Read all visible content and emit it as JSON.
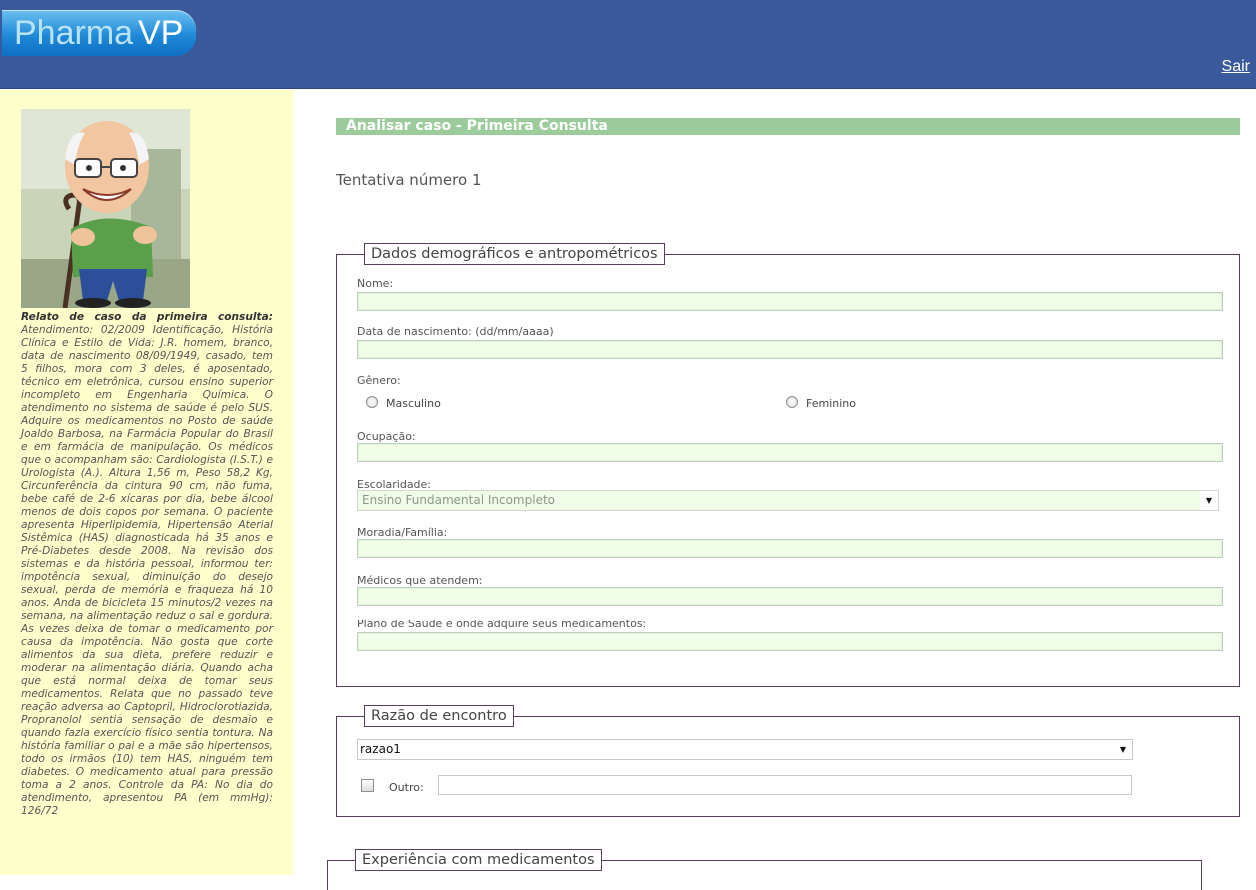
{
  "app": {
    "logo_left": "Pharma",
    "logo_right": "VP",
    "logout": "Sair"
  },
  "sidebar": {
    "case_title": "Relato de caso da primeira consulta:",
    "case_text": "Atendimento: 02/2009 Identificação, História Clínica e Estilo de Vida: J.R. homem, branco, data de nascimento 08/09/1949, casado, tem 5 filhos, mora com 3 deles, é aposentado, técnico em eletrônica, cursou ensino superior incompleto em Engenharia Química. O atendimento no sistema de saúde é pelo SUS. Adquire os medicamentos no Posto de saúde Joaldo Barbosa, na Farmácia Popular do Brasil e em farmácia de manipulação. Os médicos que o acompanham são: Cardiologista (I.S.T.) e Urologista (A.). Altura 1,56 m, Peso 58,2 Kg, Circunferência da cintura 90 cm, não fuma, bebe café de 2-6 xícaras por dia, bebe álcool menos de dois copos por semana. O paciente apresenta Hiperlipidemia, Hipertensão Aterial Sistêmica (HAS) diagnosticada há 35 anos e Pré-Diabetes desde 2008. Na revisão dos sistemas e da história pessoal, informou ter: impotência sexual, diminuição do desejo sexual, perda de memória e fraqueza há 10 anos. Anda de bicicleta 15 minutos/2 vezes na semana, na alimentação reduz o sal e gordura. As vezes deixa de tomar o medicamento por causa da impotência. Não gosta que corte alimentos da sua dieta, prefere reduzir e moderar na alimentação diária. Quando acha que está normal deixa de tomar seus medicamentos. Relata que no passado teve reação adversa ao Captopril, Hidroclorotiazida, Propranolol sentia sensação de desmaio e quando fazia exercício físico sentia tontura. Na história familiar o pai e a mãe são hipertensos, todo os irmãos (10) tem HAS, ninguém tem diabetes. O medicamento atual para pressão toma a 2 anos. Controle da PA: No dia do atendimento, apresentou PA (em mmHg): 126/72"
  },
  "main": {
    "title": "Analisar caso - Primeira Consulta",
    "attempt": "Tentativa número 1",
    "demographics": {
      "legend": "Dados demográficos e antropométricos",
      "name_label": "Nome:",
      "birth_label": "Data de nascimento: (dd/mm/aaaa)",
      "gender_label": "Gênero:",
      "gender_male": "Masculino",
      "gender_female": "Feminino",
      "occupation_label": "Ocupação:",
      "education_label": "Escolaridade:",
      "education_value": "Ensino Fundamental Incompleto",
      "housing_label": "Moradia/Família:",
      "doctors_label": "Médicos que atendem:",
      "health_plan_label": "Plano de Saúde e onde adquire seus medicamentos:"
    },
    "encounter": {
      "legend": "Razão de encontro",
      "reason_value": "razao1",
      "other_label": "Outro:"
    },
    "medication": {
      "legend": "Experiência com medicamentos"
    }
  }
}
